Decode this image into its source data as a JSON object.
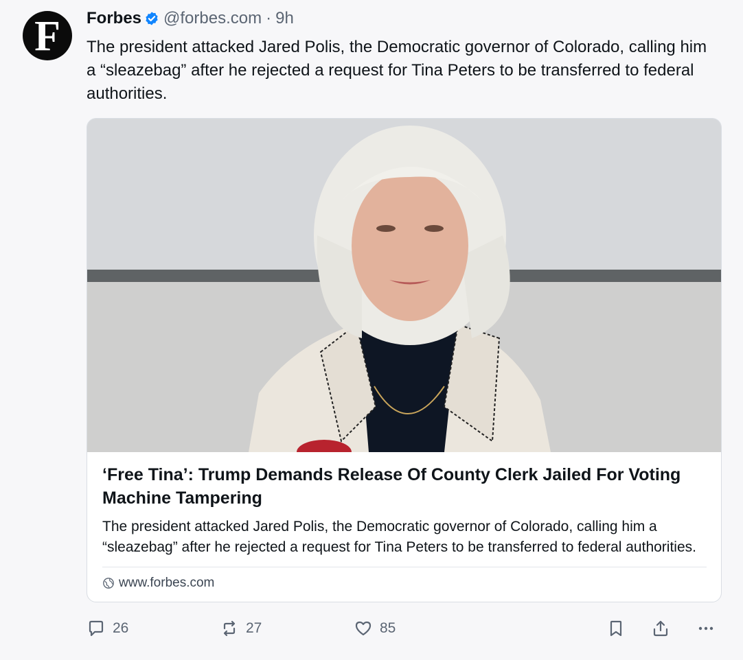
{
  "author": {
    "avatar_letter": "F",
    "display_name": "Forbes",
    "handle": "@forbes.com",
    "separator": "·",
    "time": "9h",
    "verified_icon": "verified-badge-icon"
  },
  "post": {
    "text": "The president attacked Jared Polis, the Democratic governor of Colorado, calling him a “sleazebag” after he rejected a request for Tina Peters to be transferred to federal authorities."
  },
  "link_card": {
    "title": "‘Free Tina’: Trump Demands Release Of County Clerk Jailed For Voting Machine Tampering",
    "description": "The president attacked Jared Polis, the Democratic governor of Colorado, calling him a “sleazebag” after he rejected a request for Tina Peters to be transferred to federal authorities.",
    "domain": "www.forbes.com",
    "image_alt": "Photo of a woman with white hair wearing a cream jacket",
    "domain_icon": "globe-icon"
  },
  "actions": {
    "reply_count": "26",
    "repost_count": "27",
    "like_count": "85",
    "icons": [
      "reply-icon",
      "repost-icon",
      "like-icon",
      "bookmark-icon",
      "share-icon",
      "more-icon"
    ]
  },
  "colors": {
    "verified": "#1185fe",
    "muted": "#5b6573",
    "text": "#0f1419",
    "background": "#f7f7f9"
  }
}
